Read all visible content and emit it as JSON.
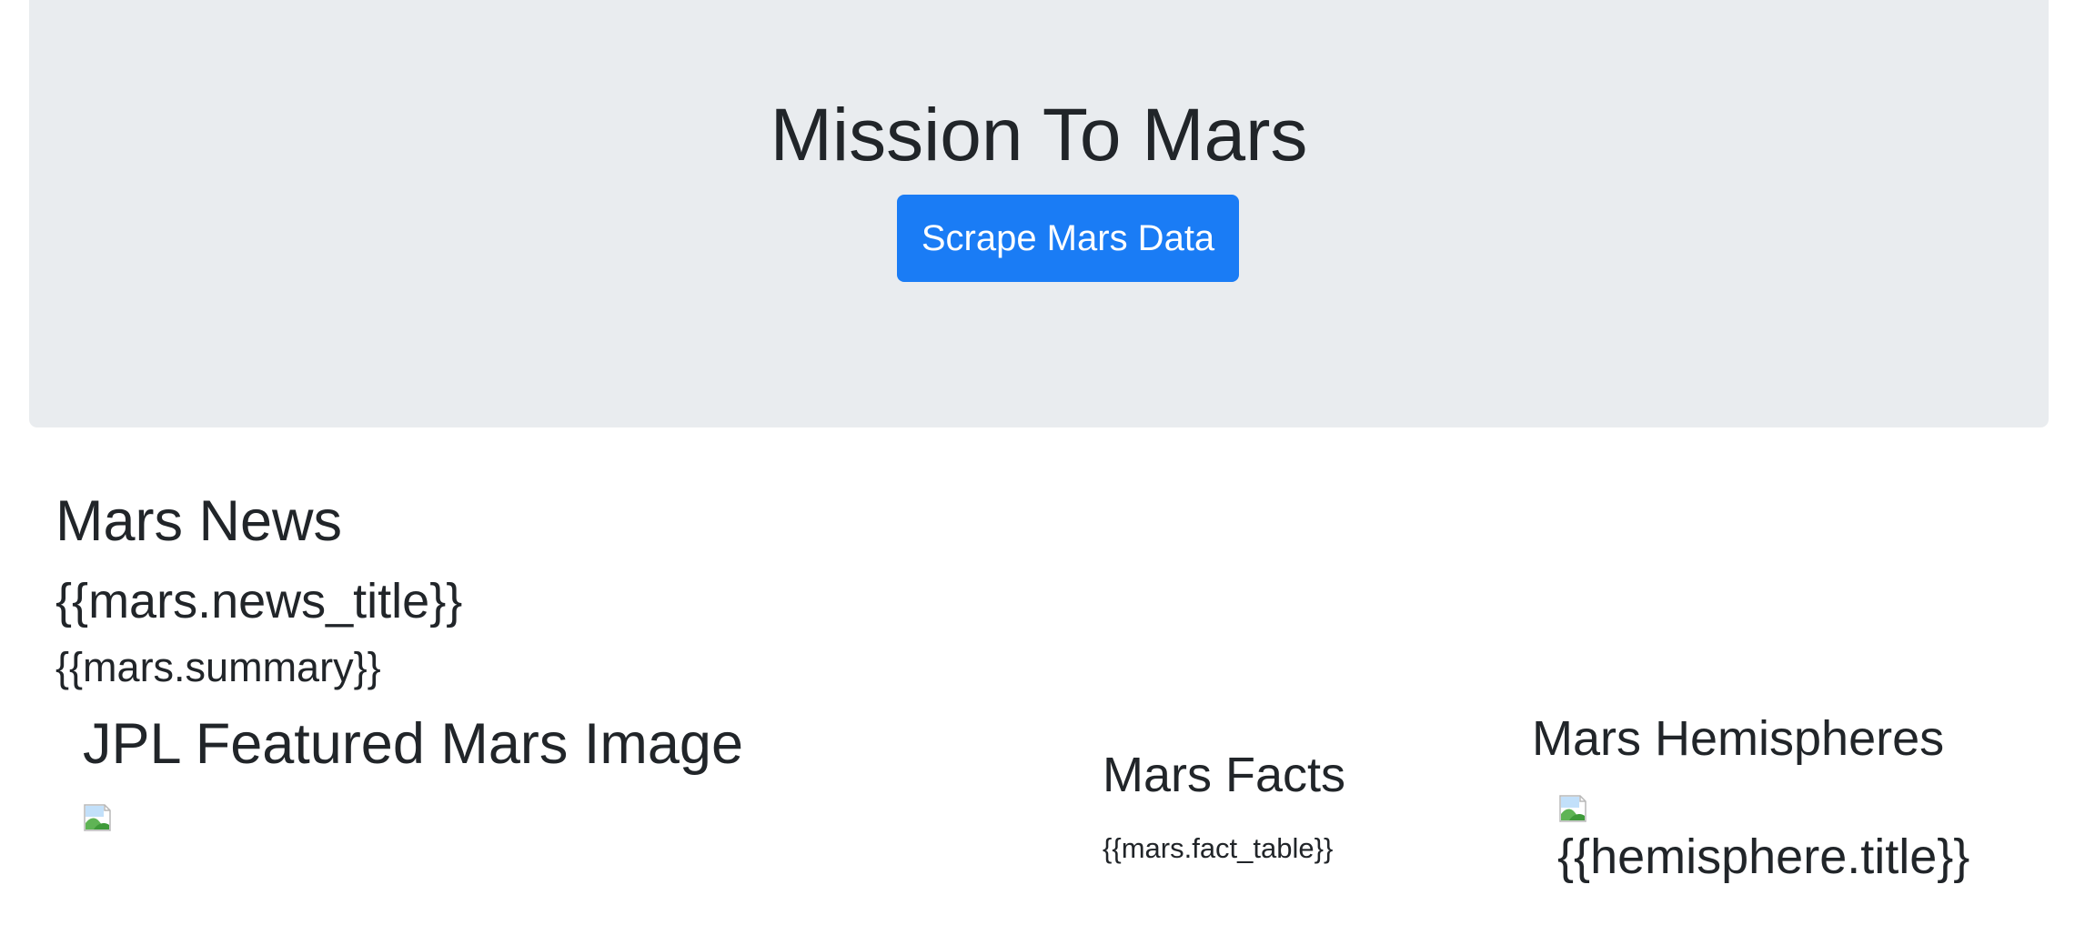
{
  "header": {
    "title": "Mission To Mars",
    "scrape_button_label": "Scrape Mars Data"
  },
  "news": {
    "heading": "Mars News",
    "title": "{{mars.news_title}}",
    "summary": "{{mars.summary}}"
  },
  "featured_image": {
    "heading": "JPL Featured Mars Image",
    "image_icon": "broken-image-icon"
  },
  "facts": {
    "heading": "Mars Facts",
    "table": "{{mars.fact_table}}"
  },
  "hemispheres": {
    "heading": "Mars Hemispheres",
    "image_icon": "broken-image-icon",
    "title": "{{hemisphere.title}}"
  },
  "colors": {
    "jumbotron_bg": "#e9ecef",
    "button_bg": "#1a7cf5",
    "text": "#212529"
  }
}
